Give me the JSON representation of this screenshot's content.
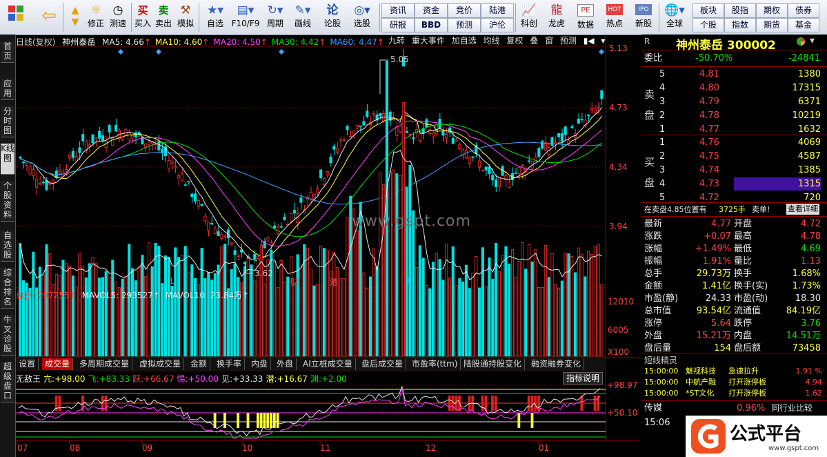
{
  "toolbar": {
    "items": [
      {
        "icon": "home-icon",
        "label": ""
      },
      {
        "icon": "back-arrow-icon",
        "label": ""
      },
      {
        "icon": "up-down-arrows-icon",
        "label": "修正"
      },
      {
        "icon": "sun-icon",
        "label": "修正"
      },
      {
        "icon": "clock-icon",
        "label": "测速"
      },
      {
        "icon": "buy-icon",
        "label": "买入",
        "glyph": "买"
      },
      {
        "icon": "sell-icon",
        "label": "卖出",
        "glyph": "卖"
      },
      {
        "icon": "gavel-icon",
        "label": "模拟"
      },
      {
        "icon": "star-icon",
        "label": "自选"
      },
      {
        "icon": "f10-icon",
        "label": "F10/F9"
      },
      {
        "icon": "cycle-icon",
        "label": "周期"
      },
      {
        "icon": "pencil-icon",
        "label": "画线"
      },
      {
        "icon": "lun-icon",
        "label": "论股",
        "glyph": "论"
      },
      {
        "icon": "target-icon",
        "label": "选股"
      }
    ],
    "grid": [
      [
        "资讯",
        "资金",
        "竞价",
        "陆港"
      ],
      [
        "研报",
        "BBD",
        "预测",
        "沪伦"
      ]
    ],
    "items2": [
      {
        "icon": "chart-icon",
        "label": "科创"
      },
      {
        "icon": "dragon-icon",
        "label": "龙虎"
      },
      {
        "icon": "pe-icon",
        "label": "数据",
        "glyph": "PE"
      },
      {
        "icon": "hot-icon",
        "label": "热点",
        "glyph": "HOT"
      },
      {
        "icon": "ipo-icon",
        "label": "新股",
        "glyph": "IPO"
      },
      {
        "icon": "globe-icon",
        "label": "全球"
      }
    ],
    "grid2": [
      [
        "板块",
        "股指",
        "期权",
        "债券"
      ],
      [
        "个股",
        "指数",
        "期货",
        "基金"
      ]
    ]
  },
  "sidebar": [
    "首页",
    "应用",
    "分时图",
    "K线图",
    "个股资料",
    "自选股",
    "综合排名",
    "牛叉诊股",
    "超级盘口"
  ],
  "kline": {
    "period_label": "日线(复权)",
    "stock_name": "神州泰岳",
    "ma": [
      {
        "name": "MA5",
        "value": "4.66",
        "color": "#e8e8e8"
      },
      {
        "name": "MA10",
        "value": "4.60",
        "color": "#ffff40"
      },
      {
        "name": "MA20",
        "value": "4.50",
        "color": "#ff40ff"
      },
      {
        "name": "MA30",
        "value": "4.42",
        "color": "#00e000"
      },
      {
        "name": "MA60",
        "value": "4.47",
        "color": "#40a0ff"
      }
    ],
    "top_buttons": [
      "九转",
      "重大事件",
      "加自选",
      "均线",
      "复权",
      "叠",
      "窗",
      "预测"
    ],
    "y_ticks": [
      "5.13",
      "4.73",
      "4.34",
      "3.94"
    ],
    "high_label": "5.05",
    "low_label": "3.62",
    "markers": [
      "L",
      "财",
      "港",
      "L"
    ],
    "watermark": "www.gspt.com"
  },
  "volume": {
    "legend": [
      {
        "name": "总手",
        "value": "297255↑",
        "color": "#ff4040"
      },
      {
        "name": "MAVOL5",
        "value": "293527↑",
        "color": "#e8e8e8"
      },
      {
        "name": "MAVOL10",
        "value": "23.84万↑",
        "color": "#e8e8e8"
      }
    ],
    "y_ticks": [
      "12010",
      "6005",
      "X100"
    ]
  },
  "tabs": [
    "设置",
    "成交量",
    "多周期成交量",
    "虚拟成交量",
    "金额",
    "换手率",
    "内盘",
    "外盘",
    "AI立桩成交量",
    "盘后成交量",
    "市盈率(ttm)",
    "陆股通持股变化",
    "融资融券变化"
  ],
  "indicator": {
    "legend": [
      {
        "name": "无敌王",
        "value": "",
        "color": "#e8e8e8"
      },
      {
        "name": "亢",
        "value": "+98.00",
        "color": "#ffff40"
      },
      {
        "name": "飞",
        "value": "+83.33",
        "color": "#00e000"
      },
      {
        "name": "跃",
        "value": "+66.67",
        "color": "#ff4040"
      },
      {
        "name": "惕",
        "value": "+50.00",
        "color": "#ff40ff"
      },
      {
        "name": "见",
        "value": "+33.33",
        "color": "#e8e8e8"
      },
      {
        "name": "潜",
        "value": "+16.67",
        "color": "#ffff40"
      },
      {
        "name": "渊",
        "value": "+2.00",
        "color": "#00e000"
      }
    ],
    "help_button": "指标说明",
    "y_ticks": [
      "+98.97",
      "+50.10"
    ]
  },
  "x_axis": [
    "07",
    "08",
    "09",
    "10",
    "11",
    "12",
    "01"
  ],
  "quote": {
    "header_r": "R",
    "title": "神州泰岳 300002",
    "weibi": {
      "label": "委比",
      "pct": "-50.70%",
      "diff": "-24841"
    },
    "sell": [
      {
        "n": "5",
        "p": "4.81",
        "v": "1380"
      },
      {
        "n": "4",
        "p": "4.80",
        "v": "17315"
      },
      {
        "n": "3",
        "p": "4.79",
        "v": "6371"
      },
      {
        "n": "2",
        "p": "4.78",
        "v": "10219"
      },
      {
        "n": "1",
        "p": "4.77",
        "v": "1632"
      }
    ],
    "sell_label": "卖盘",
    "buy": [
      {
        "n": "1",
        "p": "4.76",
        "v": "4069"
      },
      {
        "n": "2",
        "p": "4.75",
        "v": "4587"
      },
      {
        "n": "3",
        "p": "4.74",
        "v": "1385"
      },
      {
        "n": "4",
        "p": "4.73",
        "v": "1315"
      },
      {
        "n": "5",
        "p": "4.72",
        "v": "720"
      }
    ],
    "buy_label": "买盘",
    "info_line": {
      "text": "在卖盘4.85位置有",
      "amount": "3725手",
      "signal": "卖单!",
      "link": "查看详细"
    },
    "stats": [
      [
        "最新",
        "4.77",
        "开盘",
        "4.72"
      ],
      [
        "涨跌",
        "+0.07",
        "最高",
        "4.78"
      ],
      [
        "涨幅",
        "+1.49%",
        "最低",
        "4.69"
      ],
      [
        "振幅",
        "1.91%",
        "量比",
        "1.13"
      ],
      [
        "总手",
        "29.73万",
        "换手",
        "1.68%"
      ],
      [
        "金额",
        "1.41亿",
        "换手(实)",
        "1.73%"
      ],
      [
        "市盈(静)",
        "24.33",
        "市盈(动)",
        "18.30"
      ],
      [
        "总市值",
        "93.54亿",
        "流通值",
        "84.19亿"
      ],
      [
        "涨停",
        "5.64",
        "跌停",
        "3.76"
      ],
      [
        "外盘",
        "15.21万",
        "内盘",
        "14.51万"
      ],
      [
        "盘后量",
        "154",
        "盘后额",
        "73458"
      ]
    ],
    "short_title": "短线精灵",
    "short_list": [
      {
        "time": "15:00:00",
        "name": "魅视科技",
        "event": "急速拉升",
        "val": "1.91 %"
      },
      {
        "time": "15:00:00",
        "name": "中航产融",
        "event": "打开涨停板",
        "val": "4.94"
      },
      {
        "time": "15:00:00",
        "name": "*ST文化",
        "event": "打开涨停板",
        "val": "1.62"
      }
    ],
    "footer": {
      "name": "传媒",
      "pct": "0.96%",
      "compare": "同行业比较",
      "time": "15:06"
    },
    "logo": {
      "main": "公式平台",
      "url": "www.gspt.com"
    }
  }
}
